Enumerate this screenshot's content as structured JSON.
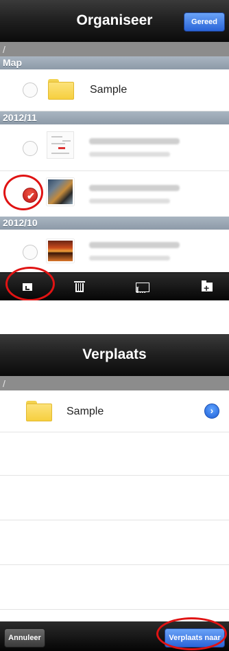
{
  "screen1": {
    "title": "Organiseer",
    "done_label": "Gereed",
    "path": "/",
    "sections": [
      {
        "header": "Map"
      },
      {
        "header": "2012/11"
      },
      {
        "header": "2012/10"
      }
    ],
    "folder_row": {
      "label": "Sample",
      "selected": false
    },
    "photo_rows": [
      {
        "thumb": "document-thumbnail",
        "selected": false
      },
      {
        "thumb": "tiger-photo-thumbnail",
        "selected": true
      },
      {
        "thumb": "sunset-photo-thumbnail",
        "selected": false
      }
    ],
    "toolbar": {
      "move_icon": "move-to-folder-icon",
      "delete_icon": "trash-icon",
      "rename_icon": "rename-icon",
      "new_folder_icon": "new-folder-icon"
    }
  },
  "screen2": {
    "title": "Verplaats",
    "path": "/",
    "folder_row": {
      "label": "Sample",
      "disclosure_icon": "chevron-right-icon"
    },
    "cancel_label": "Annuleer",
    "move_here_label": "Verplaats naar"
  },
  "colors": {
    "accent_blue": "#2a64d8",
    "highlight_red": "#e01313",
    "section_header": "#8d9aa8",
    "path_bar": "#8c8c8c"
  }
}
